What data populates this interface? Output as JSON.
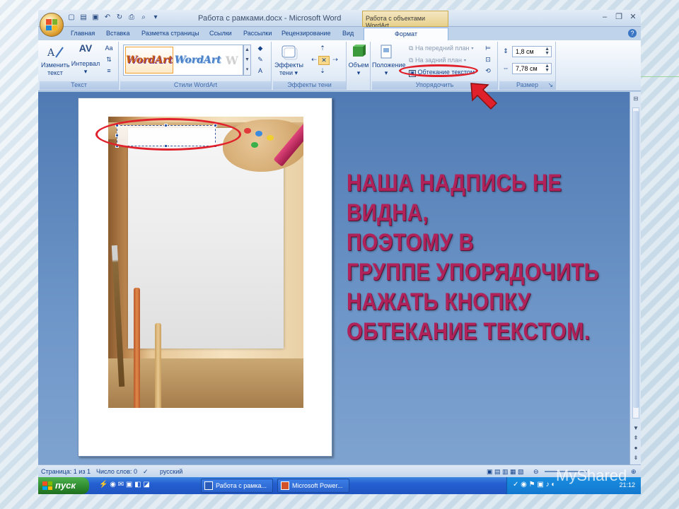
{
  "window": {
    "title": "Работа с рамками.docx - Microsoft Word",
    "context_tab_title": "Работа с объектами WordArt"
  },
  "tabs": [
    "Главная",
    "Вставка",
    "Разметка страницы",
    "Ссылки",
    "Рассылки",
    "Рецензирование",
    "Вид",
    "Формат"
  ],
  "ribbon": {
    "text_group": {
      "label": "Текст",
      "edit_text": "Изменить текст",
      "edit_text_l1": "Изменить",
      "edit_text_l2": "текст",
      "spacing": "Интервал",
      "av_icon": "AV",
      "aa_icon": "Aa"
    },
    "wordart_styles": {
      "label": "Стили WordArt",
      "samples": [
        "WordArt",
        "WordArt",
        "W"
      ]
    },
    "shadow_effects": {
      "label": "Эффекты тени",
      "button_l1": "Эффекты",
      "button_l2": "тени"
    },
    "volume": {
      "button": "Объем"
    },
    "arrange": {
      "label": "Упорядочить",
      "position_button": "Положение",
      "bring_forward": "На передний план",
      "send_backward": "На задний план",
      "text_wrap": "Обтекание текстом"
    },
    "size": {
      "label": "Размер",
      "height": "1,8 см",
      "width": "7,78 см"
    }
  },
  "statusbar": {
    "page": "Страница: 1 из 1",
    "words": "Число слов: 0",
    "language": "русский"
  },
  "taskbar": {
    "start": "пуск",
    "task1": "Работа с рамка...",
    "task2": "Microsoft Power...",
    "clock": "21:12"
  },
  "caption": {
    "lines": [
      "Наша надпись не",
      "видна,",
      "поэтому  в",
      "группе упорядочить",
      "нажать кнопку",
      "обтекание текстом."
    ]
  },
  "watermark": "MyShared",
  "colors": {
    "caption": "#b0235a",
    "highlight": "#e0202a",
    "arrow": "#e0202a"
  }
}
